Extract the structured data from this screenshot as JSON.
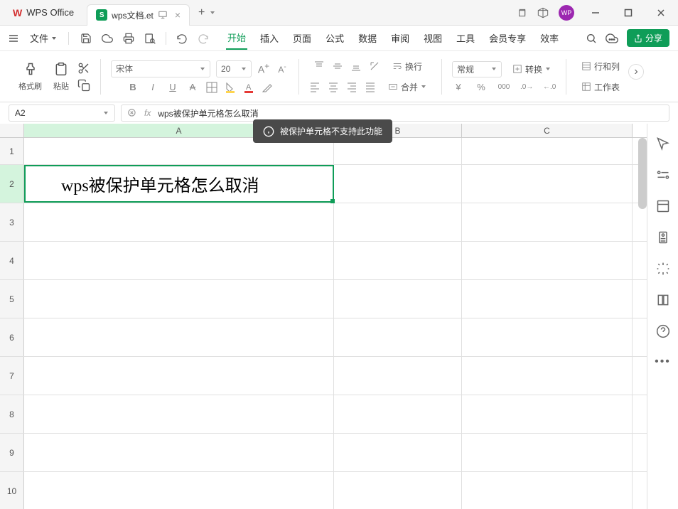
{
  "app": {
    "name": "WPS Office"
  },
  "tab": {
    "name": "wps文档.et"
  },
  "menu": {
    "file": "文件",
    "tabs": [
      "开始",
      "插入",
      "页面",
      "公式",
      "数据",
      "审阅",
      "视图",
      "工具",
      "会员专享",
      "效率"
    ],
    "active_index": 0
  },
  "share": {
    "label": "分享"
  },
  "ribbon": {
    "format_painter": "格式刷",
    "paste": "粘贴",
    "font_name": "宋体",
    "font_size": "20",
    "wrap": "换行",
    "merge": "合并",
    "number_format": "常规",
    "convert": "转换",
    "row_col": "行和列",
    "worksheet": "工作表"
  },
  "cellref": {
    "value": "A2"
  },
  "formula": {
    "value": "wps被保护单元格怎么取消"
  },
  "toast": {
    "text": "被保护单元格不支持此功能"
  },
  "grid": {
    "columns": [
      "A",
      "B",
      "C"
    ],
    "rows": [
      "1",
      "2",
      "3",
      "4",
      "5",
      "6",
      "7",
      "8",
      "9",
      "10"
    ],
    "a2": "wps被保护单元格怎么取消"
  }
}
